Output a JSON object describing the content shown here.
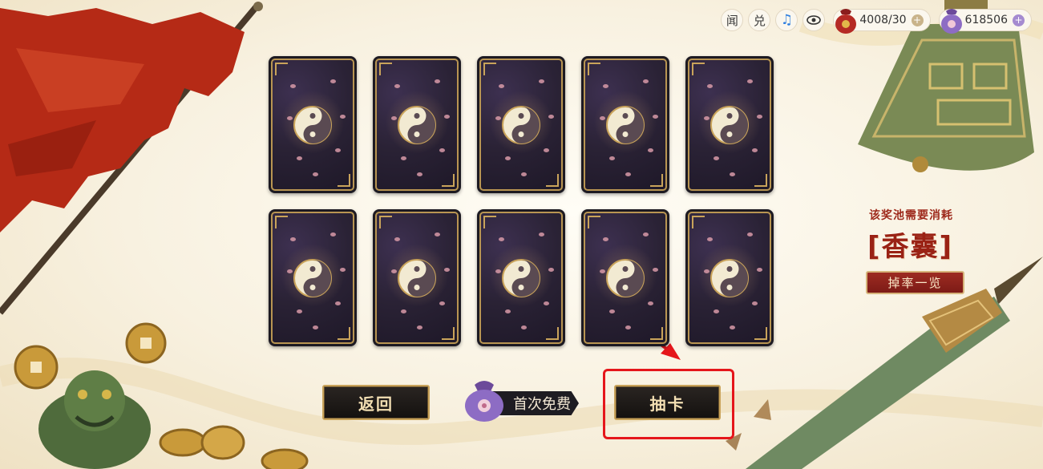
{
  "topbar": {
    "news_label": "闻",
    "exchange_label": "兑",
    "music_icon": "music-note-icon",
    "eye_icon": "eye-icon",
    "currency1": {
      "icon": "red-pouch-icon",
      "value": "4008/30",
      "plus": "+"
    },
    "currency2": {
      "icon": "purple-pouch-icon",
      "value": "618506",
      "plus": "+"
    }
  },
  "cards": [
    {
      "icon": "taiji-icon"
    },
    {
      "icon": "taiji-icon"
    },
    {
      "icon": "taiji-icon"
    },
    {
      "icon": "taiji-icon"
    },
    {
      "icon": "taiji-icon"
    },
    {
      "icon": "taiji-icon"
    },
    {
      "icon": "taiji-icon"
    },
    {
      "icon": "taiji-icon"
    },
    {
      "icon": "taiji-icon"
    },
    {
      "icon": "taiji-icon"
    }
  ],
  "pool": {
    "cost_label": "该奖池需要消耗",
    "cost_item": "[香囊]",
    "rates_button": "掉率一览"
  },
  "actions": {
    "back_button": "返回",
    "free_tag": "首次免费",
    "draw_button": "抽卡"
  },
  "colors": {
    "accent_gold": "#c9a35a",
    "accent_red": "#9a2214",
    "highlight_red": "#e5161b"
  }
}
